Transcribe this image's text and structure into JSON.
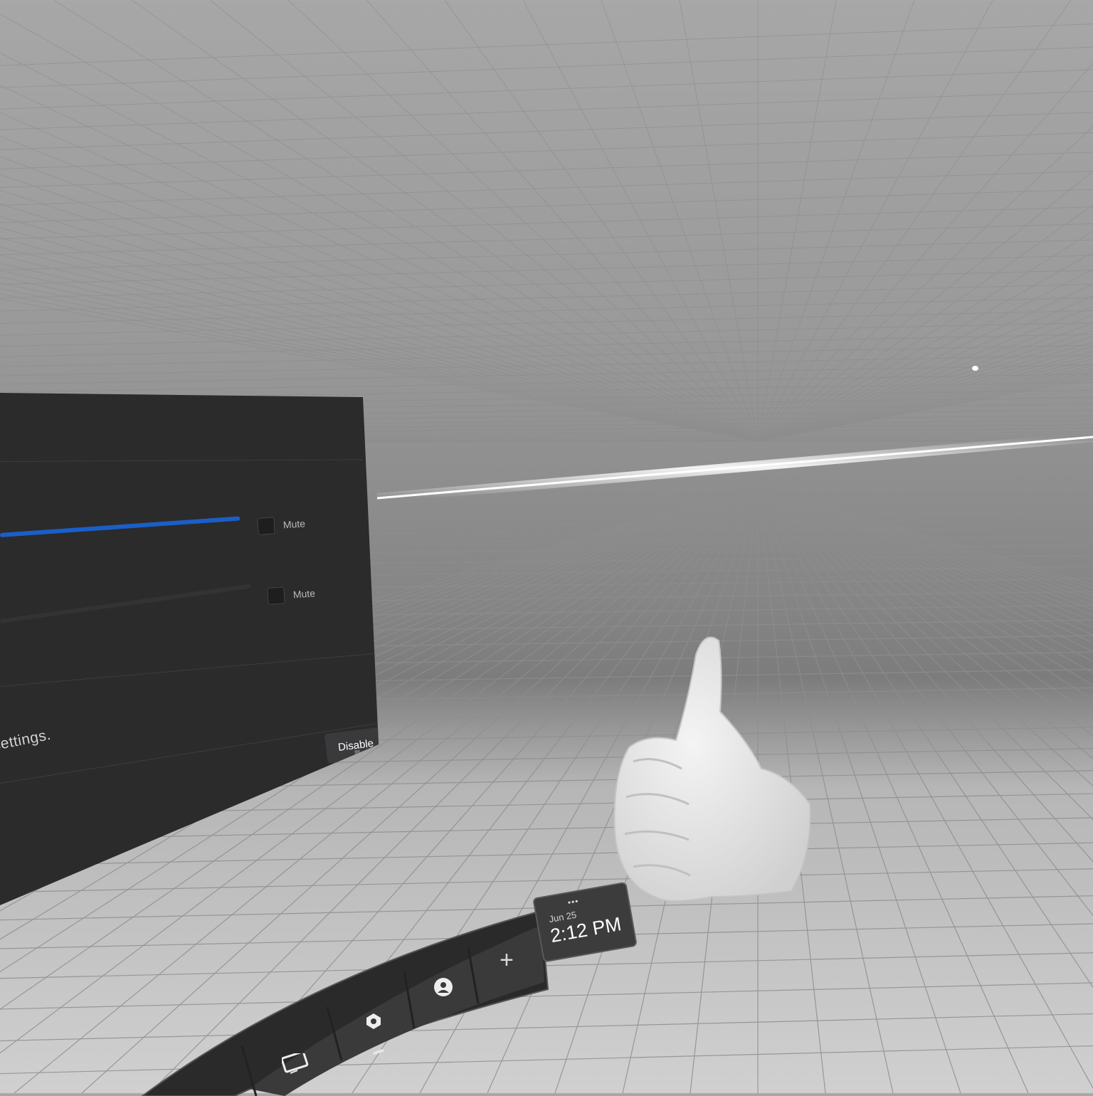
{
  "settings_panel": {
    "mute_label_1": "Mute",
    "mute_label_2": "Mute",
    "disable_button": "Disable",
    "settings_text": "d settings.",
    "accent_color": "#1a5fc7"
  },
  "clock": {
    "date": "Jun 25",
    "time": "2:12 PM",
    "more_dots": "•••"
  },
  "taskbar": {
    "add_label": "+",
    "items": [
      "display-icon",
      "apps-icon",
      "profile-icon",
      "add-icon"
    ]
  },
  "hand": {
    "gesture": "thumbs-up"
  }
}
